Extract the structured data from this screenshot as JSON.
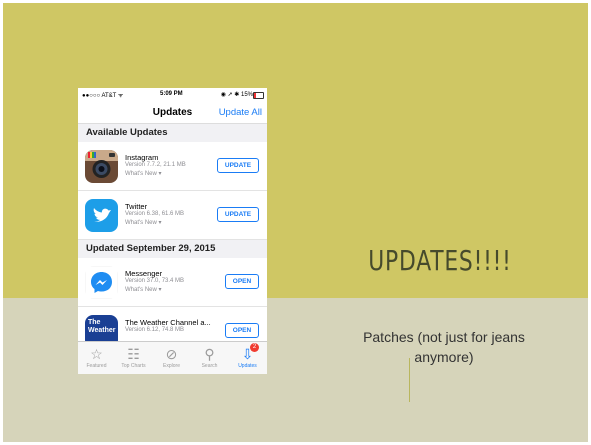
{
  "slide": {
    "title": "UPDATES!!!!",
    "body": "Patches (not just for jeans anymore)",
    "colors": {
      "top_band": "#cfc764",
      "bottom_band": "#d6d4ba",
      "title": "#464a2c"
    }
  },
  "phone": {
    "status": {
      "carrier": "●●○○○ AT&T ᯤ",
      "time": "5:09 PM",
      "right": "◉ ➚ ✱ 15%"
    },
    "nav": {
      "title": "Updates",
      "action": "Update All"
    },
    "sections": [
      {
        "label": "Available Updates"
      },
      {
        "label": "Updated September 29, 2015"
      }
    ],
    "apps": [
      {
        "name": "Instagram",
        "meta": "Version 7.7.2, 21.1 MB",
        "whats_new": "What's New ▾",
        "button": "UPDATE",
        "icon": "instagram-icon"
      },
      {
        "name": "Twitter",
        "meta": "Version 6.38, 61.6 MB",
        "whats_new": "What's New ▾",
        "button": "UPDATE",
        "icon": "twitter-icon"
      },
      {
        "name": "Messenger",
        "meta": "Version 37.0, 73.4 MB",
        "whats_new": "What's New ▾",
        "button": "OPEN",
        "icon": "messenger-icon"
      },
      {
        "name": "The Weather Channel a...",
        "meta": "Version 6.12, 74.8 MB",
        "whats_new": "",
        "button": "OPEN",
        "icon": "weather-channel-icon",
        "icon_text": "The Weather"
      }
    ],
    "tabs": [
      {
        "label": "Featured",
        "icon": "star-icon"
      },
      {
        "label": "Top Charts",
        "icon": "list-icon"
      },
      {
        "label": "Explore",
        "icon": "compass-icon"
      },
      {
        "label": "Search",
        "icon": "search-icon"
      },
      {
        "label": "Updates",
        "icon": "updates-icon",
        "badge": "2",
        "active": true
      }
    ]
  }
}
